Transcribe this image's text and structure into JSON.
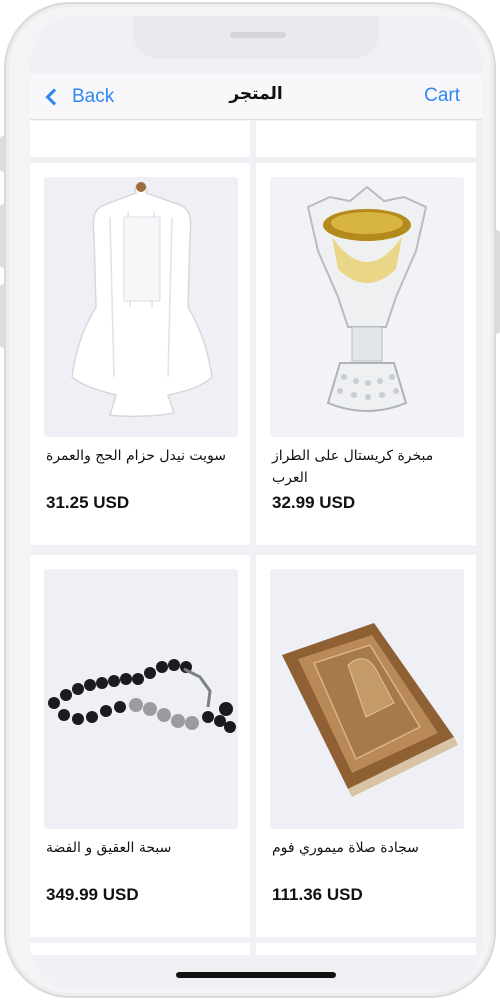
{
  "nav": {
    "back_label": "Back",
    "title": "المتجر",
    "cart_label": "Cart"
  },
  "products": [
    {
      "name": "سويت نيدل حزام الحج والعمرة",
      "price": "31.25 USD",
      "image_icon": "ihram-garment-image"
    },
    {
      "name": "مبخرة كريستال على الطراز العرب",
      "price": "32.99 USD",
      "image_icon": "crystal-incense-burner-image"
    },
    {
      "name": "سبحة العقيق و الفضة",
      "price": "349.99 USD",
      "image_icon": "prayer-beads-image"
    },
    {
      "name": "سجادة صلاة ميموري فوم",
      "price": "111.36 USD",
      "image_icon": "prayer-rug-image"
    }
  ],
  "colors": {
    "accent": "#2f86f2",
    "background": "#f1f1f5",
    "card": "#ffffff"
  }
}
